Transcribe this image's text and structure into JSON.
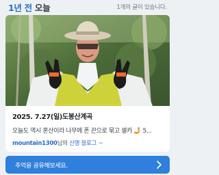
{
  "header": {
    "title_highlight": "1년 전",
    "title_rest": "오늘",
    "count_text": "1개의 글이 있습니다."
  },
  "card": {
    "date_title": "2025. 7.27(일)도봉산계곡",
    "snippet": "오늘도 역시 혼산이라 나무에 폰 끈으로 묶고 셀카 🤳 5...",
    "author": "mountain1300",
    "author_suffix": "님의",
    "blog_label": "산행 블로그",
    "blog_arrow": "~"
  },
  "share": {
    "label": "추억을 공유해보세요."
  },
  "colors": {
    "accent": "#2c6ec7",
    "share_bg": "#2f7fdc",
    "page_bg": "#eef1f4"
  },
  "icons": {
    "share_arrow": "chevron-right-icon"
  }
}
